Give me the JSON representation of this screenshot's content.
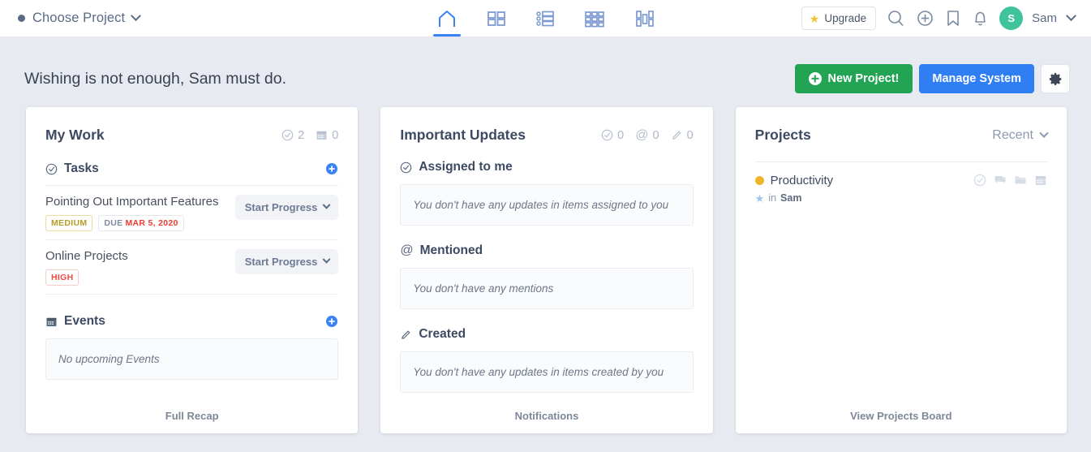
{
  "header": {
    "project_selector": {
      "label": "Choose Project",
      "dot_icon": "dot-icon",
      "chevron_icon": "chevron-down-icon"
    },
    "nav": [
      {
        "id": "home",
        "icon": "home-icon",
        "active": true
      },
      {
        "id": "dashboard",
        "icon": "grid-2x2-icon",
        "active": false
      },
      {
        "id": "list",
        "icon": "list-icon",
        "active": false
      },
      {
        "id": "grid",
        "icon": "grid-3x3-icon",
        "active": false
      },
      {
        "id": "board",
        "icon": "kanban-board-icon",
        "active": false
      }
    ],
    "upgrade": {
      "label": "Upgrade",
      "icon": "star-icon"
    },
    "tools": [
      {
        "id": "search",
        "icon": "search-icon"
      },
      {
        "id": "add",
        "icon": "plus-circle-icon"
      },
      {
        "id": "bookmark",
        "icon": "bookmark-icon"
      },
      {
        "id": "notifications",
        "icon": "bell-icon"
      }
    ],
    "user": {
      "initial": "S",
      "name": "Sam",
      "avatar_color": "#3fc39a",
      "chevron_icon": "chevron-down-icon"
    }
  },
  "greeting": "Wishing is not enough, Sam must do.",
  "actions": {
    "new_project": {
      "label": "New Project!",
      "icon": "plus-circle-icon",
      "color": "#23a455"
    },
    "manage_system": {
      "label": "Manage System",
      "color": "#2f7ef4"
    },
    "settings": {
      "icon": "gear-icon"
    }
  },
  "my_work": {
    "title": "My Work",
    "counters": [
      {
        "icon": "check-circle-icon",
        "value": "2"
      },
      {
        "icon": "calendar-icon",
        "value": "0"
      }
    ],
    "tasks_section": {
      "title": "Tasks",
      "icon": "check-circle-icon",
      "add_icon": "plus-circle-icon"
    },
    "tasks": [
      {
        "name": "Pointing Out Important Features",
        "priority": "MEDIUM",
        "priority_color": "#b49b2a",
        "due_label": "DUE",
        "due_date": "MAR 5, 2020",
        "action_label": "Start Progress"
      },
      {
        "name": "Online Projects",
        "priority": "HIGH",
        "priority_color": "#ef4b42",
        "due_label": "",
        "due_date": "",
        "action_label": "Start Progress"
      }
    ],
    "events_section": {
      "title": "Events",
      "icon": "calendar-icon",
      "add_icon": "plus-circle-icon"
    },
    "events_empty": "No upcoming Events",
    "footer": "Full Recap"
  },
  "important_updates": {
    "title": "Important Updates",
    "counters": [
      {
        "icon": "check-circle-icon",
        "value": "0"
      },
      {
        "icon": "at-sign-icon",
        "value": "0"
      },
      {
        "icon": "pencil-icon",
        "value": "0"
      }
    ],
    "sections": [
      {
        "title": "Assigned to me",
        "icon": "check-circle-icon",
        "empty": "You don't have any updates in items assigned to you"
      },
      {
        "title": "Mentioned",
        "icon": "at-sign-icon",
        "empty": "You don't have any mentions"
      },
      {
        "title": "Created",
        "icon": "pencil-icon",
        "empty": "You don't have any updates in items created by you"
      }
    ],
    "footer": "Notifications"
  },
  "projects": {
    "title": "Projects",
    "sort": {
      "label": "Recent",
      "chevron_icon": "chevron-down-icon"
    },
    "items": [
      {
        "name": "Productivity",
        "dot_color": "#f0b429",
        "owner_prefix": "in",
        "owner": "Sam",
        "star_icon": "star-icon",
        "row_icons": [
          "check-circle-icon",
          "chat-bubble-icon",
          "folder-icon",
          "calendar-icon"
        ]
      }
    ],
    "footer": "View Projects Board"
  }
}
